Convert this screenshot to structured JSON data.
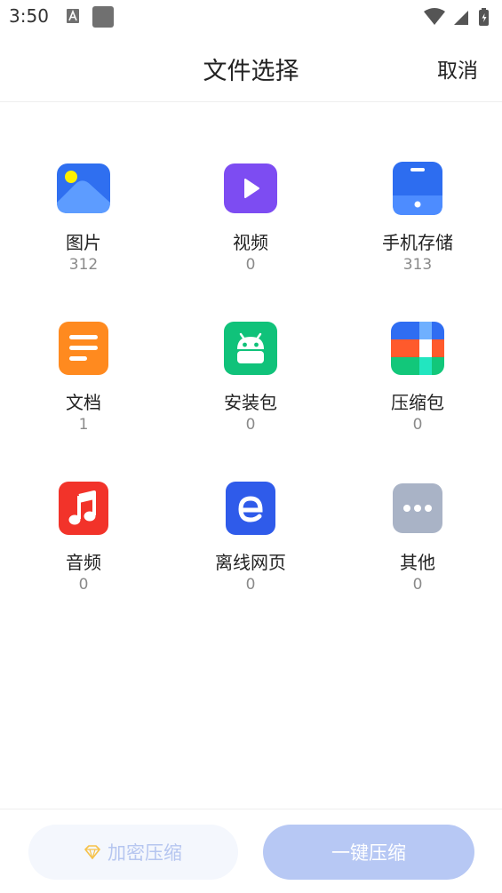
{
  "status_bar": {
    "time": "3:50"
  },
  "header": {
    "title": "文件选择",
    "cancel_label": "取消"
  },
  "categories": [
    {
      "label": "图片",
      "count": "312",
      "icon": "image-icon",
      "color": "#2f6ff0"
    },
    {
      "label": "视频",
      "count": "0",
      "icon": "video-icon",
      "color": "#7d4cf2"
    },
    {
      "label": "手机存储",
      "count": "313",
      "icon": "phone-storage-icon",
      "color": "#2d6df0"
    },
    {
      "label": "文档",
      "count": "1",
      "icon": "document-icon",
      "color": "#ff8a1f"
    },
    {
      "label": "安装包",
      "count": "0",
      "icon": "android-icon",
      "color": "#10c27a"
    },
    {
      "label": "压缩包",
      "count": "0",
      "icon": "archive-icon",
      "color": "#ff5a2c"
    },
    {
      "label": "音频",
      "count": "0",
      "icon": "music-icon",
      "color": "#f2332a"
    },
    {
      "label": "离线网页",
      "count": "0",
      "icon": "web-icon",
      "color": "#2f5bea"
    },
    {
      "label": "其他",
      "count": "0",
      "icon": "more-icon",
      "color": "#a9b3c6"
    }
  ],
  "bottom": {
    "encrypt_label": "加密压缩",
    "compress_label": "一键压缩"
  }
}
